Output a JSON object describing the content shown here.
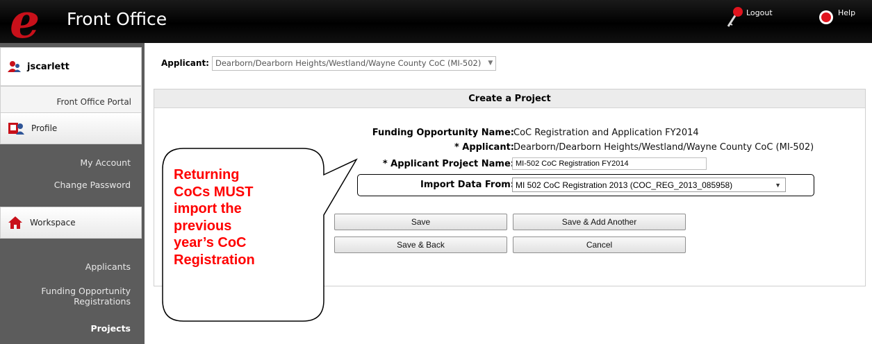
{
  "header": {
    "logo_letter": "e",
    "app_title": "Front Office",
    "logout_label": "Logout",
    "help_label": "Help"
  },
  "sidebar": {
    "username": "jscarlett",
    "portal_label": "Front Office Portal",
    "profile_label": "Profile",
    "profile_links": [
      "My Account",
      "Change Password"
    ],
    "workspace_label": "Workspace",
    "workspace_links": [
      "Applicants",
      "Funding Opportunity Registrations",
      "Projects"
    ]
  },
  "main": {
    "applicant_label": "Applicant:",
    "applicant_value": "Dearborn/Dearborn Heights/Westland/Wayne County CoC (MI-502)",
    "panel_title": "Create a Project",
    "fields": {
      "funding_label": "Funding Opportunity Name:",
      "funding_value": "CoC Registration and Application FY2014",
      "applicant_label": "* Applicant:",
      "applicant_value": "Dearborn/Dearborn Heights/Westland/Wayne County CoC (MI-502)",
      "project_name_label": "* Applicant Project Name:",
      "project_name_value": "MI-502 CoC Registration FY2014",
      "import_label": "Import Data From:",
      "import_value": "MI 502 CoC Registration 2013 (COC_REG_2013_085958)"
    },
    "buttons": {
      "save": "Save",
      "save_add": "Save & Add Another",
      "save_back": "Save & Back",
      "cancel": "Cancel"
    }
  },
  "callout": {
    "lines": [
      "Returning",
      "CoCs MUST",
      "import the",
      "previous",
      "year’s CoC",
      "Registration"
    ]
  },
  "colors": {
    "brand_red": "#c8101a",
    "callout_red": "#ff0000",
    "sidebar_bg": "#5c5c5c"
  }
}
